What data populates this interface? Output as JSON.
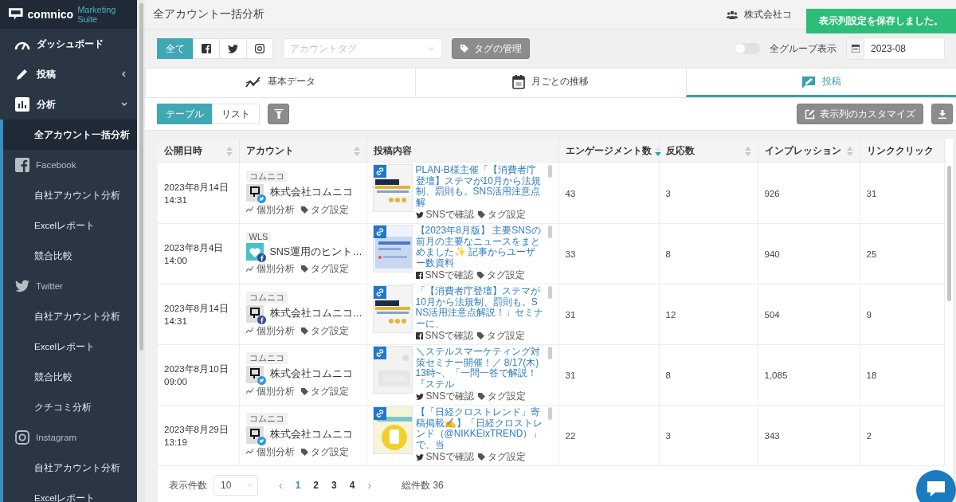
{
  "sidebar": {
    "logo": {
      "name": "comnico",
      "suffix": "Marketing Suite"
    },
    "items": [
      {
        "label": "ダッシュボード",
        "selected": false
      },
      {
        "label": "投稿",
        "selected": false,
        "expanded": false
      },
      {
        "label": "分析",
        "selected": false,
        "expanded": true,
        "children": [
          {
            "label": "全アカウント一括分析",
            "kind": "link",
            "selected": true
          },
          {
            "label": "Facebook",
            "kind": "facebook",
            "children": [
              {
                "label": "自社アカウント分析",
                "selected": false
              },
              {
                "label": "Excelレポート",
                "selected": false
              },
              {
                "label": "競合比較",
                "selected": false
              }
            ]
          },
          {
            "label": "Twitter",
            "kind": "twitter",
            "children": [
              {
                "label": "自社アカウント分析",
                "selected": false
              },
              {
                "label": "Excelレポート",
                "selected": false
              },
              {
                "label": "競合比較",
                "selected": false
              },
              {
                "label": "クチコミ分析",
                "selected": false
              }
            ]
          },
          {
            "label": "Instagram",
            "kind": "instagram",
            "children": [
              {
                "label": "自社アカウント分析",
                "selected": false
              },
              {
                "label": "Excelレポート",
                "selected": false
              }
            ]
          }
        ]
      }
    ]
  },
  "header": {
    "title": "全アカウント一括分析",
    "account": "株式会社コ"
  },
  "toast": "表示列設定を保存しました。",
  "filters": {
    "networks": [
      {
        "label": "全て",
        "kind": "all",
        "selected": true
      },
      {
        "kind": "facebook",
        "selected": false
      },
      {
        "kind": "twitter",
        "selected": false
      },
      {
        "kind": "instagram",
        "selected": false
      }
    ],
    "tag_select": {
      "placeholder": "アカウントタグ"
    },
    "tag_button": "タグの管理",
    "all_groups": {
      "label": "全グループ表示",
      "on": false
    },
    "month": {
      "value": "2023-08"
    }
  },
  "tabs": [
    {
      "label": "基本データ",
      "selected": false
    },
    {
      "label": "月ごとの推移",
      "selected": false
    },
    {
      "label": "投稿",
      "selected": true
    }
  ],
  "view": {
    "modes": [
      {
        "label": "テーブル",
        "selected": true
      },
      {
        "label": "リスト",
        "selected": false
      }
    ],
    "customize_button": "表示列のカスタマイズ"
  },
  "table": {
    "columns": [
      {
        "label": "公開日時",
        "sortable": true,
        "sorted": false
      },
      {
        "label": "アカウント",
        "sortable": true,
        "sorted": false
      },
      {
        "label": "投稿内容",
        "sortable": false
      },
      {
        "label": "エンゲージメント数",
        "sortable": true,
        "sorted": true
      },
      {
        "label": "反応数",
        "sortable": true,
        "sorted": false
      },
      {
        "label": "インプレッション",
        "sortable": true,
        "sorted": false
      },
      {
        "label": "リンククリック",
        "sortable": false
      }
    ],
    "rows": [
      {
        "date": "2023年8月14日 14:31",
        "account": {
          "tag": "コムニコ",
          "name": "株式会社コムニコ",
          "kind": "twitter",
          "links": [
            "個別分析",
            "タグ設定"
          ]
        },
        "post": {
          "text": "PLAN-B様主催「【消費者庁登壇】ステマが10月から法規制、罰則も。SNS活用注意点解",
          "kind": "twitter",
          "links": [
            "SNSで確認",
            "タグ設定"
          ]
        },
        "values": [
          "43",
          "3",
          "926",
          "31"
        ]
      },
      {
        "date": "2023年8月4日 14:00",
        "account": {
          "tag": "WLS",
          "name": "SNS運用のヒント…",
          "kind": "facebook",
          "links": [
            "個別分析",
            "タグ設定"
          ]
        },
        "post": {
          "text": "【2023年8月版】 主要SNSの前月の主要なニュースをまとめました✨ 記事からユーザー数資料",
          "kind": "facebook",
          "links": [
            "SNSで確認",
            "タグ設定"
          ]
        },
        "values": [
          "33",
          "8",
          "940",
          "25"
        ]
      },
      {
        "date": "2023年8月14日 14:31",
        "account": {
          "tag": "コムニコ",
          "name": "株式会社コムニコ…",
          "kind": "facebook",
          "links": [
            "個別分析",
            "タグ設定"
          ]
        },
        "post": {
          "text": "「【消費者庁登壇】ステマが10月から法規制、罰則も。SNS活用注意点解説！」セミナーに、",
          "kind": "facebook",
          "links": [
            "SNSで確認",
            "タグ設定"
          ]
        },
        "values": [
          "31",
          "12",
          "504",
          "9"
        ]
      },
      {
        "date": "2023年8月10日 09:00",
        "account": {
          "tag": "コムニコ",
          "name": "株式会社コムニコ",
          "kind": "twitter",
          "links": [
            "個別分析",
            "タグ設定"
          ]
        },
        "post": {
          "text": "＼ステルスマーケティング対策セミナー開催！／ 8/17(木)13時~、「一問一答で解説！『ステル",
          "kind": "twitter",
          "links": [
            "SNSで確認",
            "タグ設定"
          ]
        },
        "values": [
          "31",
          "8",
          "1,085",
          "18"
        ]
      },
      {
        "date": "2023年8月29日 13:19",
        "account": {
          "tag": "コムニコ",
          "name": "株式会社コムニコ",
          "kind": "twitter",
          "links": [
            "個別分析",
            "タグ設定"
          ]
        },
        "post": {
          "text": "【「日経クロストレンド」寄稿掲載✍️】「日経クロストレンド（@NIKKEIxTREND）」で、当",
          "kind": "twitter",
          "links": [
            "SNSで確認",
            "タグ設定"
          ]
        },
        "values": [
          "22",
          "3",
          "343",
          "2"
        ]
      }
    ]
  },
  "pagination": {
    "page_size_label": "表示件数",
    "page_size": "10",
    "prev": "‹",
    "next": "›",
    "pages": [
      {
        "label": "1",
        "selected": true
      },
      {
        "label": "2",
        "selected": false
      },
      {
        "label": "3",
        "selected": false
      },
      {
        "label": "4",
        "selected": false
      }
    ],
    "total": "総件数 36"
  }
}
